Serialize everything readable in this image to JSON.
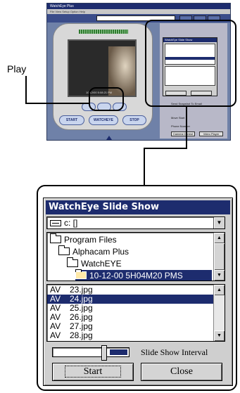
{
  "thumbnail": {
    "title": "WatchEye Plus",
    "menu": "File  View  Setup  Option  Help",
    "timestamp": "10/12/00 5:08:21 PM",
    "start_label": "START",
    "watcheye_label": "WATCHEYE",
    "stop_label": "STOP",
    "slideshow_caption": "WatchEye Slide Show",
    "option_send_snapshot": "Send Snapshot To Email",
    "option_move_start": "Move Start",
    "phone_label": "Phone Number",
    "btn_camera_control": "Camera Control",
    "btn_video_player": "Video Player"
  },
  "annotation": {
    "play_label": "Play"
  },
  "slideshow": {
    "title": "WatchEye Slide Show",
    "drive": "c: []",
    "directories": [
      {
        "name": "Program Files",
        "indent": 0,
        "selected": false
      },
      {
        "name": "Alphacam Plus",
        "indent": 1,
        "selected": false
      },
      {
        "name": "WatchEYE",
        "indent": 2,
        "selected": false
      },
      {
        "name": "10-12-00 5H04M20 PMS",
        "indent": 3,
        "selected": true
      }
    ],
    "files": [
      {
        "prefix": "AV",
        "name": "23.jpg",
        "selected": false
      },
      {
        "prefix": "AV",
        "name": "24.jpg",
        "selected": true
      },
      {
        "prefix": "AV",
        "name": "25.jpg",
        "selected": false
      },
      {
        "prefix": "AV",
        "name": "26.jpg",
        "selected": false
      },
      {
        "prefix": "AV",
        "name": "27.jpg",
        "selected": false
      },
      {
        "prefix": "AV",
        "name": "28.jpg",
        "selected": false
      }
    ],
    "interval_label": "Slide Show Interval",
    "interval_level": 0.7,
    "start_button": "Start",
    "close_button": "Close"
  },
  "colors": {
    "selection": "#1d2c6e",
    "window_face": "#cfcfcf"
  }
}
